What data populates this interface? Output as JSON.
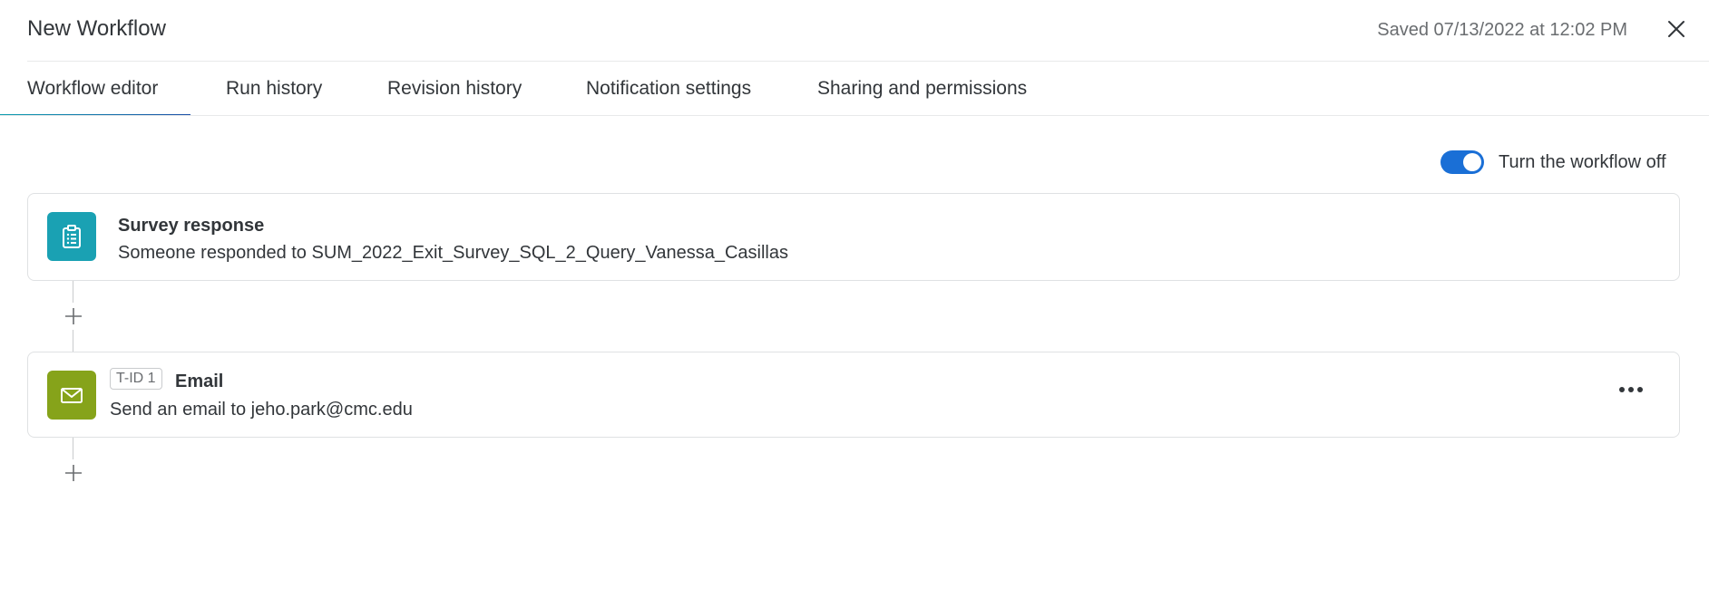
{
  "header": {
    "title": "New Workflow",
    "saved_text": "Saved 07/13/2022 at 12:02 PM",
    "close_icon": "close-icon"
  },
  "tabs": [
    {
      "label": "Workflow editor",
      "active": true
    },
    {
      "label": "Run history",
      "active": false
    },
    {
      "label": "Revision history",
      "active": false
    },
    {
      "label": "Notification settings",
      "active": false
    },
    {
      "label": "Sharing and permissions",
      "active": false
    }
  ],
  "toggle": {
    "label": "Turn the workflow off",
    "on": true,
    "color": "#1a6fd6"
  },
  "trigger": {
    "icon": "clipboard-icon",
    "icon_color": "#1aa1b3",
    "title": "Survey response",
    "description": "Someone responded to SUM_2022_Exit_Survey_SQL_2_Query_Vanessa_Casillas"
  },
  "task": {
    "icon": "envelope-icon",
    "icon_color": "#86a31a",
    "badge": "T-ID 1",
    "title": "Email",
    "description": "Send an email to jeho.park@cmc.edu",
    "more_icon": "more-options-icon"
  },
  "add_icon": "plus-icon"
}
